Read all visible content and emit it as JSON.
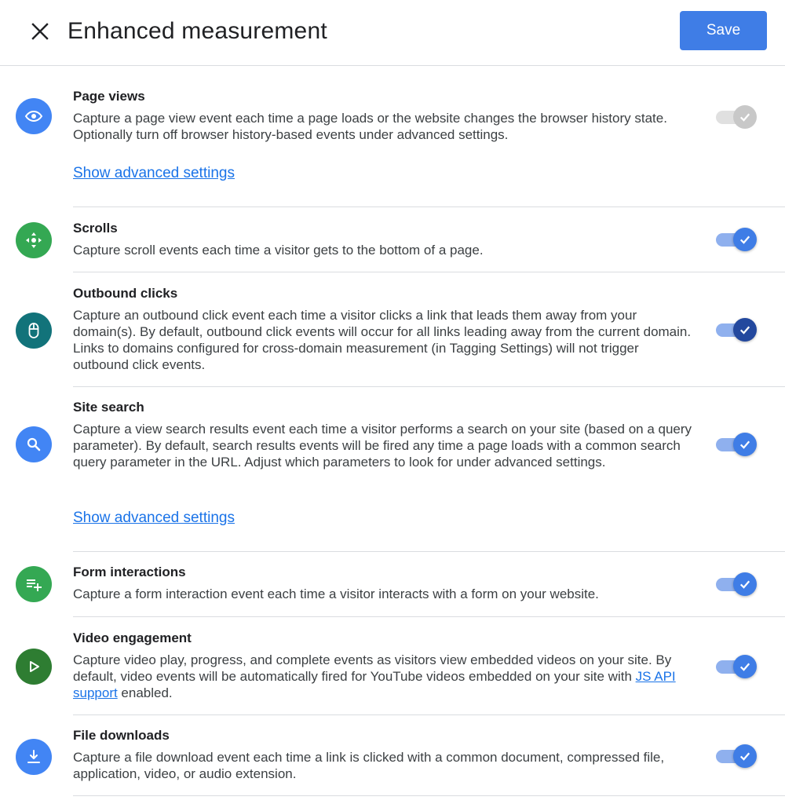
{
  "header": {
    "title": "Enhanced measurement",
    "save_label": "Save"
  },
  "sections": [
    {
      "title": "Page views",
      "description": "Capture a page view event each time a page loads or the website changes the browser history state. Optionally turn off browser history-based events under advanced settings.",
      "advanced_link": "Show advanced settings",
      "icon": "eye-icon",
      "icon_color": "#4285f4",
      "toggle": "on-disabled"
    },
    {
      "title": "Scrolls",
      "description": "Capture scroll events each time a visitor gets to the bottom of a page.",
      "icon": "scroll-arrows-icon",
      "icon_color": "#34a853",
      "toggle": "on"
    },
    {
      "title": "Outbound clicks",
      "description": "Capture an outbound click event each time a visitor clicks a link that leads them away from your domain(s). By default, outbound click events will occur for all links leading away from the current domain. Links to domains configured for cross-domain measurement (in Tagging Settings) will not trigger outbound click events.",
      "icon": "mouse-icon",
      "icon_color": "#12737a",
      "toggle": "on-focused"
    },
    {
      "title": "Site search",
      "description": "Capture a view search results event each time a visitor performs a search on your site (based on a query parameter). By default, search results events will be fired any time a page loads with a common search query parameter in the URL. Adjust which parameters to look for under advanced settings.",
      "advanced_link": "Show advanced settings",
      "icon": "search-icon",
      "icon_color": "#4285f4",
      "toggle": "on"
    },
    {
      "title": "Form interactions",
      "description": "Capture a form interaction event each time a visitor interacts with a form on your website.",
      "icon": "playlist-add-icon",
      "icon_color": "#34a853",
      "toggle": "on"
    },
    {
      "title": "Video engagement",
      "description_pre": "Capture video play, progress, and complete events as visitors view embedded videos on your site. By default, video events will be automatically fired for YouTube videos embedded on your site with ",
      "description_link": "JS API support",
      "description_post": " enabled.",
      "icon": "play-icon",
      "icon_color": "#2e7d32",
      "toggle": "on"
    },
    {
      "title": "File downloads",
      "description": "Capture a file download event each time a link is clicked with a common document, compressed file, application, video, or audio extension.",
      "icon": "download-icon",
      "icon_color": "#4285f4",
      "toggle": "on"
    }
  ]
}
